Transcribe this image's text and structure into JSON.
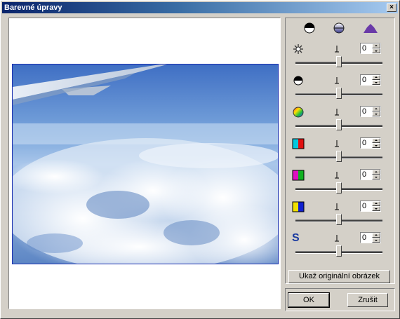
{
  "window": {
    "title": "Barevné úpravy",
    "close_glyph": "×"
  },
  "tabs": [
    {
      "name": "contrast-tab",
      "icon": "half-circle-icon"
    },
    {
      "name": "saturation-tab",
      "icon": "gradient-circle-icon"
    },
    {
      "name": "curves-tab",
      "icon": "histogram-icon"
    }
  ],
  "adjustments": [
    {
      "id": "brightness",
      "icon": "sun-icon",
      "value": "0",
      "level": 0.5
    },
    {
      "id": "contrast",
      "icon": "half-circle-icon",
      "value": "0",
      "level": 0.5
    },
    {
      "id": "hue",
      "icon": "color-wheel-icon",
      "value": "0",
      "level": 0.5
    },
    {
      "id": "cyan-red",
      "icon": "cyan-red-icon",
      "value": "0",
      "level": 0.5
    },
    {
      "id": "magenta-green",
      "icon": "magenta-green-icon",
      "value": "0",
      "level": 0.5
    },
    {
      "id": "yellow-blue",
      "icon": "yellow-blue-icon",
      "value": "0",
      "level": 0.5
    },
    {
      "id": "sharpness",
      "icon": "s-letter-icon",
      "value": "0",
      "level": 0.5,
      "glyph": "S"
    }
  ],
  "buttons": {
    "show_original": "Ukaž originální obrázek",
    "ok": "OK",
    "cancel": "Zrušit"
  },
  "colors": {
    "titlebar_start": "#0a246a",
    "titlebar_end": "#a6caf0",
    "face": "#d4d0c8",
    "image_border": "#1a2fb0"
  }
}
